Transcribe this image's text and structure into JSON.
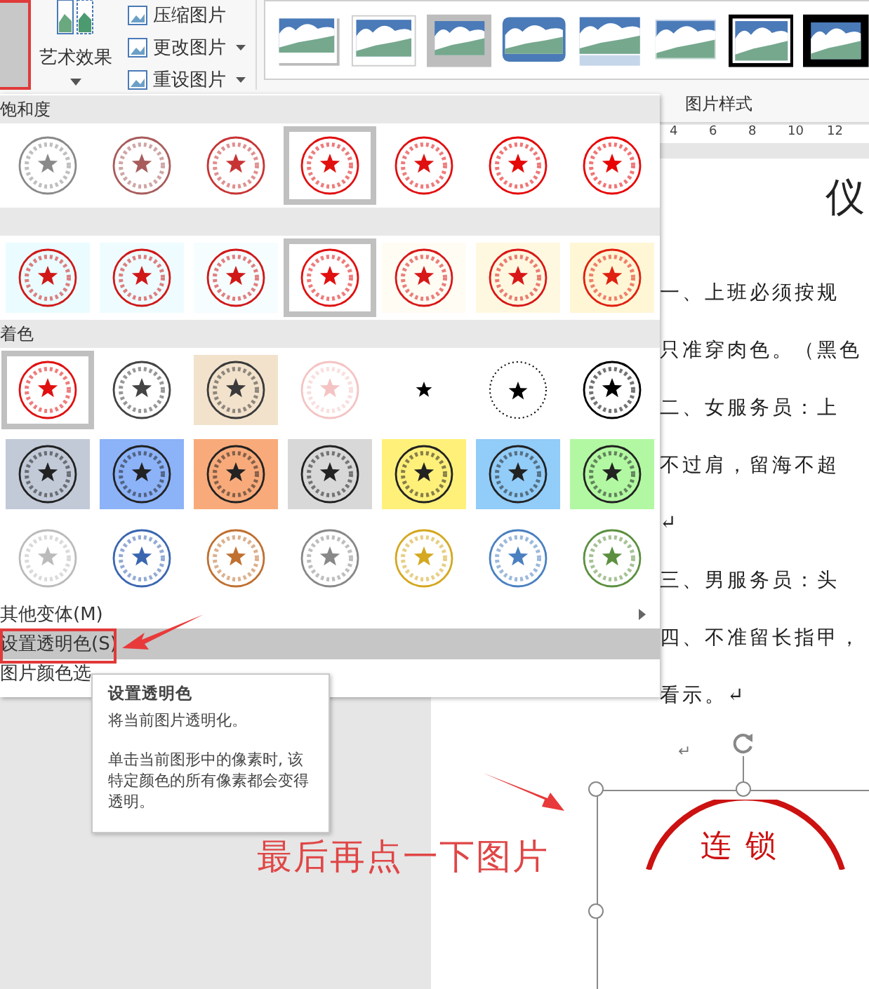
{
  "ribbon": {
    "art_effects": {
      "label": "艺术效果"
    },
    "commands": [
      {
        "label": "压缩图片",
        "dropdown": false
      },
      {
        "label": "更改图片",
        "dropdown": true
      },
      {
        "label": "重设图片",
        "dropdown": true
      }
    ],
    "picture_styles": [
      {
        "kind": "drop-shadow"
      },
      {
        "kind": "thin-frame"
      },
      {
        "kind": "thick-frame"
      },
      {
        "kind": "rounded"
      },
      {
        "kind": "reflection"
      },
      {
        "kind": "soft-edge"
      },
      {
        "kind": "double-frame"
      },
      {
        "kind": "black-frame"
      }
    ],
    "group_label": "图片样式"
  },
  "ruler": {
    "ticks": [
      "4",
      "6",
      "8",
      "10",
      "12"
    ]
  },
  "document": {
    "title": "仪",
    "lines": [
      "一、上班必须按规",
      "只准穿肉色。（黑色",
      "二、女服务员：上",
      "不过肩，留海不超",
      "↵",
      "三、男服务员：头",
      "四、不准留长指甲，",
      "看示。↵"
    ],
    "paragraph_mark": "↵",
    "image": {
      "stamp_text": "连锁",
      "selected": true
    }
  },
  "color_panel": {
    "sections": [
      {
        "title": "饱和度",
        "rows": [
          [
            {
              "kind": "stamp",
              "color": "#ffffff",
              "ink": {
                "color": "#8a8a8a"
              },
              "selected": false
            },
            {
              "kind": "stamp",
              "color": "#ffffff",
              "ink": {
                "color": "#a85c5c"
              },
              "selected": false
            },
            {
              "kind": "stamp",
              "color": "#ffffff",
              "ink": {
                "color": "#c83434"
              },
              "selected": false
            },
            {
              "kind": "stamp",
              "color": "#ffffff",
              "ink": {
                "color": "#e01010"
              },
              "selected": true
            },
            {
              "kind": "stamp",
              "color": "#ffffff",
              "ink": {
                "color": "#e01010"
              },
              "selected": false
            },
            {
              "kind": "stamp",
              "color": "#ffffff",
              "ink": {
                "color": "#e40808"
              },
              "selected": false
            },
            {
              "kind": "stamp",
              "color": "#ffffff",
              "ink": {
                "color": "#e80404"
              },
              "selected": false
            }
          ]
        ]
      },
      {
        "rows": [
          [
            {
              "kind": "stamp",
              "color": "#eafcff",
              "ink": {
                "color": "#d01818"
              },
              "selected": false
            },
            {
              "kind": "stamp",
              "color": "#eefcff",
              "ink": {
                "color": "#d01818"
              },
              "selected": false
            },
            {
              "kind": "stamp",
              "color": "#f6fdff",
              "ink": {
                "color": "#d01818"
              },
              "selected": false
            },
            {
              "kind": "stamp",
              "color": "#ffffff",
              "ink": {
                "color": "#e01010"
              },
              "selected": true
            },
            {
              "kind": "stamp",
              "color": "#fffcf4",
              "ink": {
                "color": "#d81818"
              },
              "selected": false
            },
            {
              "kind": "stamp",
              "color": "#fff8e0",
              "ink": {
                "color": "#d81818"
              },
              "selected": false
            },
            {
              "kind": "stamp",
              "color": "#fff6d6",
              "ink": {
                "color": "#e02010"
              },
              "selected": false
            }
          ]
        ]
      },
      {
        "title": "着色",
        "rows": [
          [
            {
              "kind": "stamp",
              "color": "#ffffff",
              "ink": {
                "color": "#e01010"
              },
              "selected": true
            },
            {
              "kind": "stamp",
              "color": "#ffffff",
              "ink": {
                "color": "#444444"
              },
              "selected": false
            },
            {
              "kind": "stamp",
              "color": "#f2e2cc",
              "ink": {
                "color": "#3a3a3a"
              },
              "selected": false
            },
            {
              "kind": "stamp",
              "color": "#ffffff",
              "ink": {
                "color": "#f4c4c4"
              },
              "selected": false
            },
            {
              "kind": "star-only",
              "color": "#ffffff",
              "ink": {
                "color": "#000000"
              },
              "selected": false
            },
            {
              "kind": "dotted",
              "color": "#ffffff",
              "ink": {
                "color": "#000000"
              },
              "selected": false
            },
            {
              "kind": "stamp",
              "color": "#ffffff",
              "ink": {
                "color": "#000000"
              },
              "selected": false
            }
          ],
          [
            {
              "kind": "stamp",
              "color": "#c2cad8",
              "ink": {
                "color": "#222222"
              },
              "selected": false
            },
            {
              "kind": "stamp",
              "color": "#8cb2f8",
              "ink": {
                "color": "#222222"
              },
              "selected": false
            },
            {
              "kind": "stamp",
              "color": "#f8aa7a",
              "ink": {
                "color": "#222222"
              },
              "selected": false
            },
            {
              "kind": "stamp",
              "color": "#d8d8d8",
              "ink": {
                "color": "#222222"
              },
              "selected": false
            },
            {
              "kind": "stamp",
              "color": "#fff07a",
              "ink": {
                "color": "#222222"
              },
              "selected": false
            },
            {
              "kind": "stamp",
              "color": "#92ccf8",
              "ink": {
                "color": "#222222"
              },
              "selected": false
            },
            {
              "kind": "stamp",
              "color": "#b2f8a2",
              "ink": {
                "color": "#222222"
              },
              "selected": false
            }
          ],
          [
            {
              "kind": "stamp",
              "color": "#ffffff",
              "ink": {
                "color": "#bbbbbb"
              },
              "selected": false
            },
            {
              "kind": "stamp",
              "color": "#ffffff",
              "ink": {
                "color": "#3a66b0"
              },
              "selected": false
            },
            {
              "kind": "stamp",
              "color": "#ffffff",
              "ink": {
                "color": "#c07030"
              },
              "selected": false
            },
            {
              "kind": "stamp",
              "color": "#ffffff",
              "ink": {
                "color": "#888888"
              },
              "selected": false
            },
            {
              "kind": "stamp",
              "color": "#ffffff",
              "ink": {
                "color": "#d4a820"
              },
              "selected": false
            },
            {
              "kind": "stamp",
              "color": "#ffffff",
              "ink": {
                "color": "#4a80c0"
              },
              "selected": false
            },
            {
              "kind": "stamp",
              "color": "#ffffff",
              "ink": {
                "color": "#5c9040"
              },
              "selected": false
            }
          ]
        ]
      }
    ],
    "menu": [
      {
        "label": "其他变体(M)",
        "submenu": true,
        "selected": false
      },
      {
        "label": "设置透明色(S)",
        "submenu": false,
        "selected": true
      },
      {
        "label": "图片颜色选",
        "submenu": false,
        "selected": false
      }
    ]
  },
  "tooltip": {
    "title": "设置透明色",
    "lines": [
      "将当前图片透明化。",
      "单击当前图形中的像素时, 该特定颜色的所有像素都会变得透明。"
    ]
  },
  "annotation": {
    "caption": "最后再点一下图片"
  }
}
